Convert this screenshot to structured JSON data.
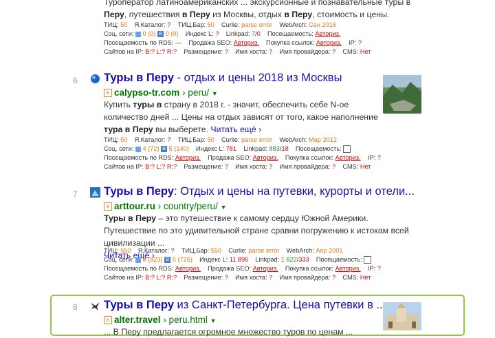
{
  "results": [
    {
      "snippet_top_line1": "Туроператор латиноамериканских ... экскурсионные и познавательные туры в",
      "snippet_top_line2_a": "Перу",
      "snippet_top_line2_b": ", путешествия ",
      "snippet_top_line2_c": "в Перу",
      "snippet_top_line2_d": " из Москвы, отдых ",
      "snippet_top_line2_e": "в Перу",
      "snippet_top_line2_f": ", стоимость и цены.",
      "m1": {
        "tic_label": "ТИЦ:",
        "tic": "50",
        "cat_label": "Я.Каталог:",
        "cat": "?",
        "bar_label": "ТИЦ.Бар:",
        "bar": "50",
        "curlie_label": "Curlie:",
        "curlie": "parse error",
        "wa_label": "WebArch:",
        "wa": "Сен 2016"
      },
      "m2": {
        "soc_label": "Соц. сети:",
        "soc": "0 (0)",
        "soc2": "0 (0)",
        "idx_label": "Индекс L:",
        "idx": "?",
        "lp_label": "Linkpad:",
        "lp_a": "7",
        "lp_b": "0",
        "pos_label": "Посещаемость:",
        "pos": "Авториз."
      },
      "m3": {
        "rds_label": "Посещаемость по RDS:",
        "rds": "—",
        "seo_label": "Продажа SEO:",
        "seo": "Авториз.",
        "buy_label": "Покупка ссылок:",
        "buy": "Авториз.",
        "ip_label": "IP:",
        "ip": "?"
      },
      "m4": {
        "sip_label": "Сайтов на IP:",
        "sip": "B:?  L:?  R:?",
        "place_label": "Размещение:",
        "place": "?",
        "host_label": "Имя хоста:",
        "host": "?",
        "prov_label": "Имя провайдера:",
        "prov": "?",
        "cms_label": "CMS:",
        "cms": "Нет"
      }
    },
    {
      "num": "6",
      "title_a": "Туры в Перу",
      "title_b": " - отдых и цены 2018 из Москвы",
      "domain": "calypso-tr.com",
      "path": "› peru/",
      "snip_a": "Купить ",
      "snip_b": "туры в",
      "snip_c": " страну в 2018 г. - значит, обеспечить себе N-ое количество дней ... Цены на отдых зависят от того, какое наполнение ",
      "snip_d": "тура в Перу",
      "snip_e": " вы выберете.",
      "more": "Читать ещё ›",
      "m1": {
        "tic_label": "ТИЦ:",
        "tic": "50",
        "cat_label": "Я.Каталог:",
        "cat": "?",
        "bar_label": "ТИЦ.Бар:",
        "bar": "50",
        "curlie_label": "Curlie:",
        "curlie": "parse error",
        "wa_label": "WebArch:",
        "wa": "Мар 2012"
      },
      "m2": {
        "soc_label": "Соц. сети:",
        "soc": "4 (72)",
        "soc2": "5 (140)",
        "idx_label": "Индекс L:",
        "idx": "781",
        "lp_label": "Linkpad:",
        "lp_a": "883",
        "lp_b": "18",
        "pos_label": "Посещаемость:"
      },
      "m3": {
        "rds_label": "Посещаемость по RDS:",
        "rds": "Авториз.",
        "seo_label": "Продажа SEO:",
        "seo": "Авториз.",
        "buy_label": "Покупка ссылок:",
        "buy": "Авториз.",
        "ip_label": "IP:",
        "ip": "?"
      },
      "m4": {
        "sip_label": "Сайтов на IP:",
        "sip": "B:?  L:?  R:?",
        "place_label": "Размещение:",
        "place": "?",
        "host_label": "Имя хоста:",
        "host": "?",
        "prov_label": "Имя провайдера:",
        "prov": "?",
        "cms_label": "CMS:",
        "cms": "Нет"
      }
    },
    {
      "num": "7",
      "title_a": "Туры в Перу",
      "title_b": ": Отдых и цены на путевки, курорты и отели...",
      "domain": "arttour.ru",
      "path": "› country/peru/",
      "snip_a": "Туры в Перу",
      "snip_b": " – это путешествие к самому сердцу Южной Америки. Путешествие по это удивительной стране сравни погружению к истокам всей цивилизации ...",
      "more": "Читать ещё ›",
      "m1": {
        "tic_label": "ТИЦ:",
        "tic": "550",
        "cat_label": "Я.Каталог:",
        "cat": "?",
        "bar_label": "ТИЦ.Бар:",
        "bar": "550",
        "curlie_label": "Curlie:",
        "curlie": "parse error",
        "wa_label": "WebArch:",
        "wa": "Апр 2001"
      },
      "m2": {
        "soc_label": "Соц. сети:",
        "soc": "0 (823)",
        "soc2": "5 (725)",
        "idx_label": "Индекс L:",
        "idx": "11 896",
        "lp_label": "Linkpad:",
        "lp_a": "1 822",
        "lp_b": "333",
        "pos_label": "Посещаемость:"
      },
      "m3": {
        "rds_label": "Посещаемость по RDS:",
        "rds": "Авториз.",
        "seo_label": "Продажа SEO:",
        "seo": "Авториз.",
        "buy_label": "Покупка ссылок:",
        "buy": "Авториз.",
        "ip_label": "IP:",
        "ip": "?"
      },
      "m4": {
        "sip_label": "Сайтов на IP:",
        "sip": "B:?  L:?  R:?",
        "place_label": "Размещение:",
        "place": "?",
        "host_label": "Имя хоста:",
        "host": "?",
        "prov_label": "Имя провайдера:",
        "prov": "?",
        "cms_label": "CMS:",
        "cms": "Нет"
      }
    },
    {
      "num": "8",
      "title_a": "Туры в Перу",
      "title_b": " из Санкт-Петербурга. Цена путевки в ...",
      "domain": "alter.travel",
      "path": "› peru.html",
      "snip_partial": "... В Перу предлагается огромное множество туров по ценам ..."
    }
  ],
  "colors": {
    "link": "#1a0dab",
    "url": "#007700",
    "highlight_border": "#92c740",
    "metric_red": "#dd0000"
  }
}
